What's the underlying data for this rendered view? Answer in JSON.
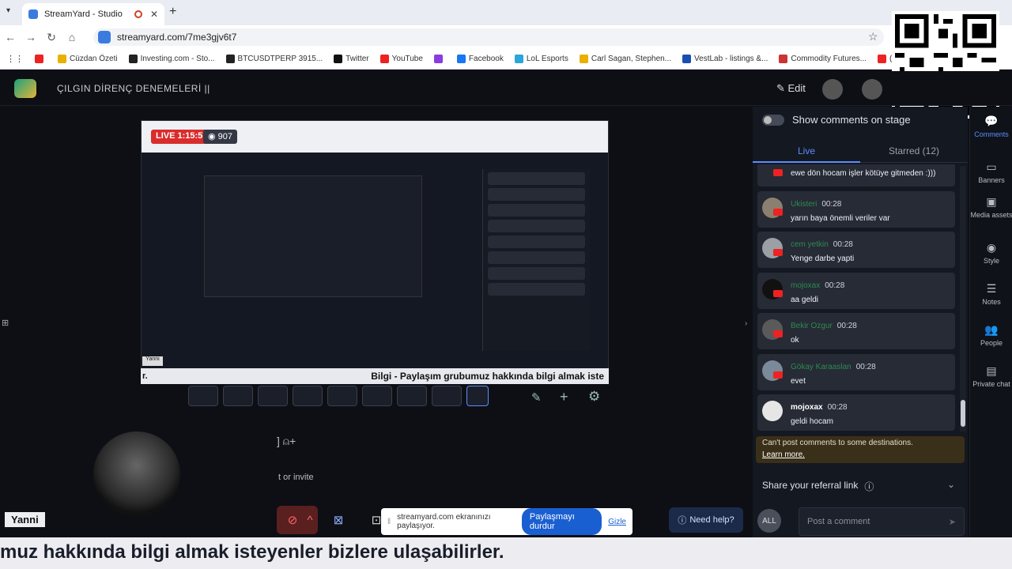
{
  "browser": {
    "tab_title": "StreamYard - Studio",
    "tab_close": "✕",
    "new_tab": "+",
    "url": "streamyard.com/7me3gjv6t7",
    "bookmarks": [
      {
        "label": "",
        "color": "#e22"
      },
      {
        "label": "Cüzdan Özeti",
        "color": "#e9b000"
      },
      {
        "label": "Investing.com - Sto...",
        "color": "#222"
      },
      {
        "label": "BTCUSDTPERP 3915...",
        "color": "#222"
      },
      {
        "label": "Twitter",
        "color": "#111"
      },
      {
        "label": "YouTube",
        "color": "#e22"
      },
      {
        "label": "",
        "color": "#8a3ce0"
      },
      {
        "label": "Facebook",
        "color": "#1877f2"
      },
      {
        "label": "LoL Esports",
        "color": "#2aa6d8"
      },
      {
        "label": "Carl Sagan, Stephen...",
        "color": "#e9b000"
      },
      {
        "label": "VestLab - listings &...",
        "color": "#1a4fb0"
      },
      {
        "label": "Commodity Futures...",
        "color": "#c33"
      },
      {
        "label": "(16) Johnny Cash -...",
        "color": "#e22"
      }
    ]
  },
  "app": {
    "title": "ÇILGIN DİRENÇ DENEMELERİ ||",
    "edit_label": "Edit"
  },
  "stage": {
    "live_label": "LIVE 1:15:57",
    "viewers": "907",
    "banner_text": "Bilgi - Paylaşım grubumuz hakkında bilgi almak iste",
    "inner_name": "Yanni",
    "name_tag": "Yanni",
    "invite_text": "t or invite",
    "left_text": "r."
  },
  "share_bar": {
    "message": "streamyard.com ekranınızı paylaşıyor.",
    "stop_label": "Paylaşmayı durdur",
    "hide_label": "Gizle"
  },
  "need_help": "Need help?",
  "ticker": "muz hakkında bilgi almak isteyenler bizlere ulaşabilirler.",
  "comments_panel": {
    "show_on_stage": "Show comments on stage",
    "tab_live": "Live",
    "tab_starred": "Starred (12)",
    "first_text": "ewe dön hocam işler kötüye gitmeden :)))",
    "items": [
      {
        "name": "Ukisteri",
        "time": "00:28",
        "text": "yarın baya önemli veriler var",
        "avatar": "#8b8070"
      },
      {
        "name": "cem yetkin",
        "time": "00:28",
        "text": "Yenge darbe yapti",
        "avatar": "#9aa0a6"
      },
      {
        "name": "mojoxax",
        "time": "00:28",
        "text": "aa geldi",
        "avatar": "#111"
      },
      {
        "name": "Bekir Ozgur",
        "time": "00:28",
        "text": "ok",
        "avatar": "#5a5a5a"
      },
      {
        "name": "Gökay Karaaslan",
        "time": "00:28",
        "text": "evet",
        "avatar": "#7a8a9a"
      },
      {
        "name": "mojoxax",
        "time": "00:28",
        "text": "geldi hocam",
        "avatar": "#e6e6e6"
      }
    ],
    "cant_post": "Can't post comments to some destinations.",
    "learn_more": "Learn more.",
    "referral": "Share your referral link",
    "all_label": "ALL",
    "post_placeholder": "Post a comment"
  },
  "rail": [
    {
      "label": "Comments",
      "icon": "💬"
    },
    {
      "label": "Banners",
      "icon": "▭"
    },
    {
      "label": "Media assets",
      "icon": "▣"
    },
    {
      "label": "Style",
      "icon": "◉"
    },
    {
      "label": "Notes",
      "icon": "☰"
    },
    {
      "label": "People",
      "icon": "👥"
    },
    {
      "label": "Private chat",
      "icon": "▤"
    }
  ]
}
